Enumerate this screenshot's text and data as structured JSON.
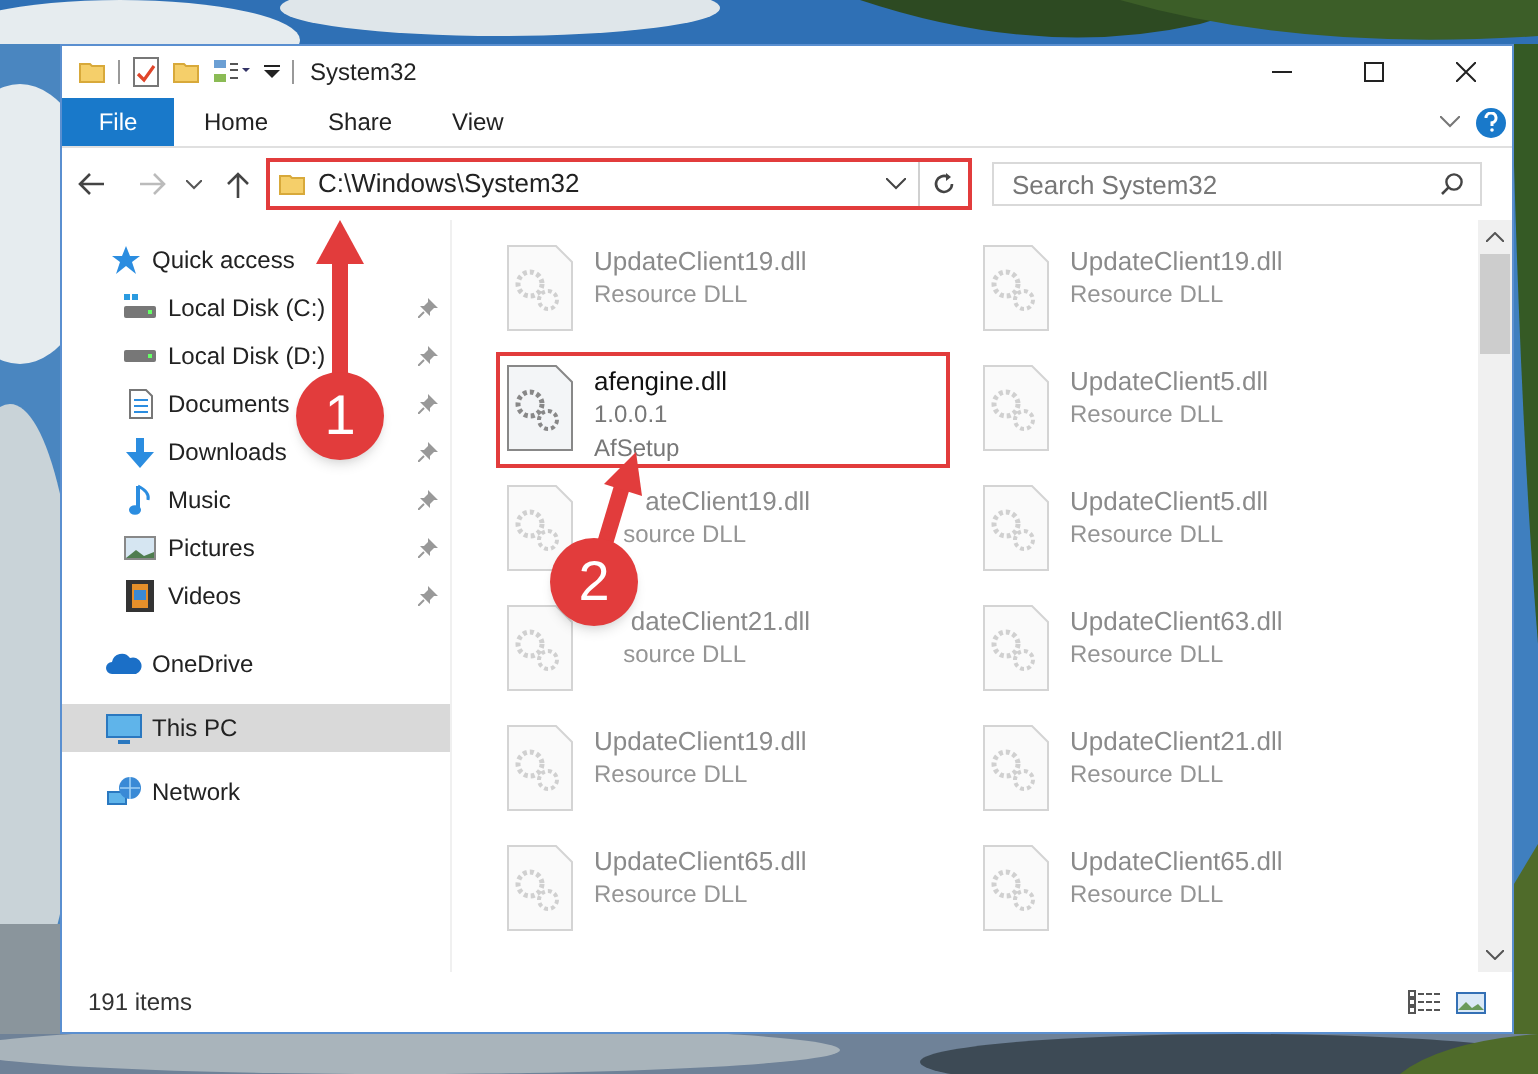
{
  "window": {
    "title": "System32"
  },
  "ribbon_tabs": [
    {
      "label": "File",
      "kind": "file"
    },
    {
      "label": "Home",
      "kind": "tab"
    },
    {
      "label": "Share",
      "kind": "tab"
    },
    {
      "label": "View",
      "kind": "tab"
    }
  ],
  "address_bar": {
    "path": "C:\\Windows\\System32",
    "highlighted": true
  },
  "search": {
    "placeholder": "Search System32"
  },
  "nav": [
    {
      "label": "Quick access",
      "selected": false,
      "children": [
        {
          "label": "Local Disk (C:)",
          "pinned": true
        },
        {
          "label": "Local Disk (D:)",
          "pinned": true
        },
        {
          "label": "Documents",
          "pinned": true
        },
        {
          "label": "Downloads",
          "pinned": true
        },
        {
          "label": "Music",
          "pinned": true
        },
        {
          "label": "Pictures",
          "pinned": true
        },
        {
          "label": "Videos",
          "pinned": true
        }
      ]
    },
    {
      "label": "OneDrive",
      "selected": false
    },
    {
      "label": "This PC",
      "selected": true
    },
    {
      "label": "Network",
      "selected": false
    }
  ],
  "files": [
    {
      "name": "UpdateClient19.dll",
      "details": [
        "Resource DLL"
      ],
      "blurred": true,
      "highlighted": false,
      "covered": false
    },
    {
      "name": "UpdateClient19.dll",
      "details": [
        "Resource DLL"
      ],
      "blurred": true,
      "highlighted": false,
      "covered": false
    },
    {
      "name": "afengine.dll",
      "details": [
        "1.0.0.1",
        "AfSetup"
      ],
      "blurred": false,
      "highlighted": true,
      "covered": false
    },
    {
      "name": "UpdateClient5.dll",
      "details": [
        "Resource DLL"
      ],
      "blurred": true,
      "highlighted": false,
      "covered": false
    },
    {
      "name": "ateClient19.dll",
      "details": [
        "source DLL"
      ],
      "blurred": true,
      "highlighted": false,
      "covered": true
    },
    {
      "name": "UpdateClient5.dll",
      "details": [
        "Resource DLL"
      ],
      "blurred": true,
      "highlighted": false,
      "covered": false
    },
    {
      "name": "dateClient21.dll",
      "details": [
        "source DLL"
      ],
      "blurred": true,
      "highlighted": false,
      "covered": true
    },
    {
      "name": "UpdateClient63.dll",
      "details": [
        "Resource DLL"
      ],
      "blurred": true,
      "highlighted": false,
      "covered": false
    },
    {
      "name": "UpdateClient19.dll",
      "details": [
        "Resource DLL"
      ],
      "blurred": true,
      "highlighted": false,
      "covered": false
    },
    {
      "name": "UpdateClient21.dll",
      "details": [
        "Resource DLL"
      ],
      "blurred": true,
      "highlighted": false,
      "covered": false
    },
    {
      "name": "UpdateClient65.dll",
      "details": [
        "Resource DLL"
      ],
      "blurred": true,
      "highlighted": false,
      "covered": false
    },
    {
      "name": "UpdateClient65.dll",
      "details": [
        "Resource DLL"
      ],
      "blurred": true,
      "highlighted": false,
      "covered": false
    }
  ],
  "status_bar": {
    "item_count": "191 items"
  },
  "callouts": [
    {
      "number": "1"
    },
    {
      "number": "2"
    }
  ]
}
